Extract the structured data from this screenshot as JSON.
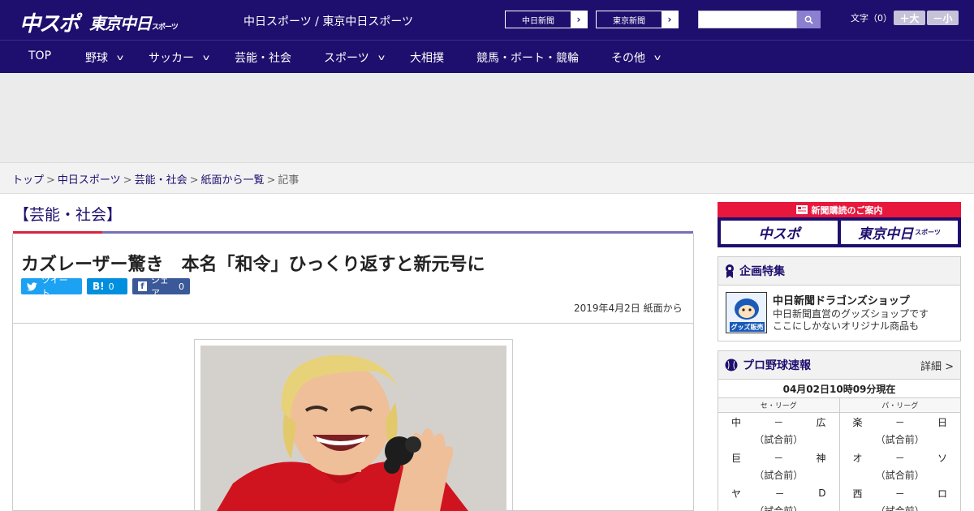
{
  "header": {
    "logo_main": "中スポ",
    "logo_tokyo": "東京中日",
    "logo_tokyo_sub": "スポーツ",
    "site_title": "中日スポーツ / 東京中日スポーツ",
    "paper_links": [
      "中日新聞",
      "東京新聞"
    ],
    "font_label": "文字（0）",
    "font_bigger": "＋大",
    "font_smaller": "－小"
  },
  "nav": {
    "items": [
      {
        "label": "TOP",
        "has_menu": false
      },
      {
        "label": "野球",
        "has_menu": true
      },
      {
        "label": "サッカー",
        "has_menu": true
      },
      {
        "label": "芸能・社会",
        "has_menu": false
      },
      {
        "label": "スポーツ",
        "has_menu": true
      },
      {
        "label": "大相撲",
        "has_menu": false
      },
      {
        "label": "競馬・ボート・競輪",
        "has_menu": false
      },
      {
        "label": "その他",
        "has_menu": true
      }
    ]
  },
  "breadcrumb": {
    "items": [
      "トップ",
      "中日スポーツ",
      "芸能・社会",
      "紙面から一覧"
    ],
    "current": "記事"
  },
  "article": {
    "category": "【芸能・社会】",
    "headline": "カズレーザー驚き　本名「和令」ひっくり返すと新元号に",
    "share": {
      "tweet": "ツイート",
      "hatena_count": "0",
      "facebook_label": "シェア",
      "facebook_count": "0"
    },
    "date": "2019年4月2日 紙面から"
  },
  "sidebar": {
    "subscription_title": "新聞購読のご案内",
    "subscription_logos": [
      "中スポ",
      "東京中日"
    ],
    "subscription_logo_sub": "スポーツ",
    "feature": {
      "heading": "企画特集",
      "thumb_label": "グッズ販売中",
      "title": "中日新聞ドラゴンズショップ",
      "desc_line1": "中日新聞直営のグッズショップです",
      "desc_line2": "ここにしかないオリジナル商品も"
    },
    "baseball": {
      "heading": "プロ野球速報",
      "more": "詳細 >",
      "updated": "04月02日10時09分現在",
      "leagues": [
        "セ・リーグ",
        "パ・リーグ"
      ],
      "central": [
        {
          "home": "中",
          "score": "－",
          "away": "広",
          "status": "（試合前）"
        },
        {
          "home": "巨",
          "score": "－",
          "away": "神",
          "status": "（試合前）"
        },
        {
          "home": "ヤ",
          "score": "－",
          "away": "D",
          "status": "（試合前）"
        }
      ],
      "pacific": [
        {
          "home": "楽",
          "score": "－",
          "away": "日",
          "status": "（試合前）"
        },
        {
          "home": "オ",
          "score": "－",
          "away": "ソ",
          "status": "（試合前）"
        },
        {
          "home": "西",
          "score": "－",
          "away": "ロ",
          "status": "（試合前）"
        }
      ]
    }
  },
  "colors": {
    "brand_navy": "#1e0f6e",
    "accent_red": "#d7263d",
    "twitter": "#1da1f2",
    "hatena": "#008fde",
    "facebook": "#3b5998"
  }
}
